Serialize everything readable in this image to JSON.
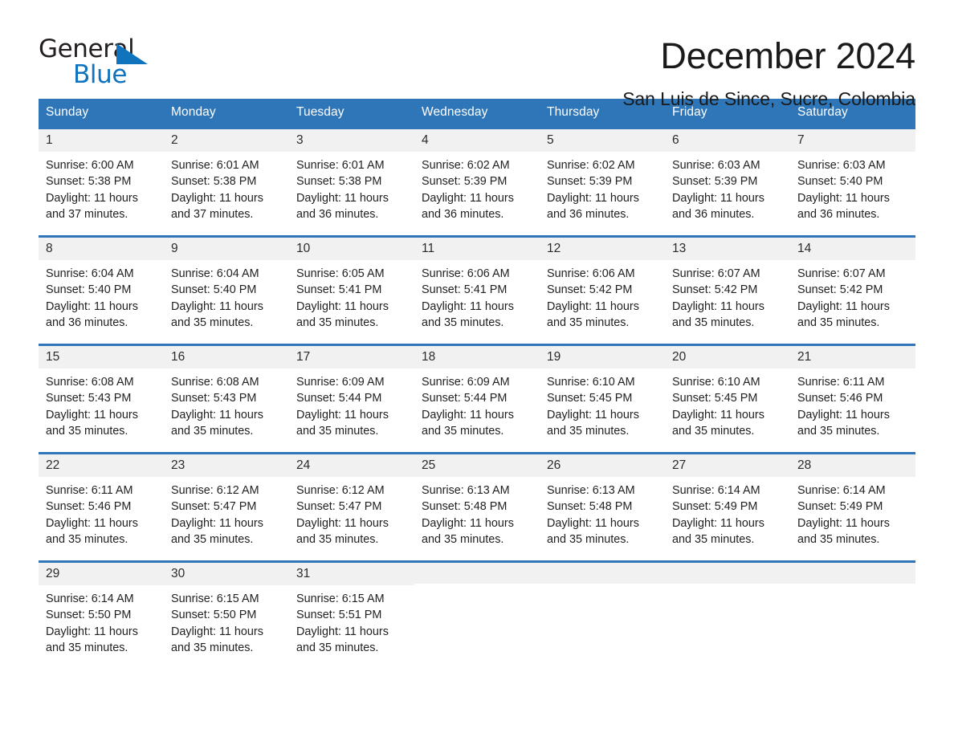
{
  "brand": {
    "name_top": "General",
    "name_bottom": "Blue",
    "accent_color": "#1073be",
    "triangle_icon": "triangle-icon"
  },
  "header": {
    "title": "December 2024",
    "location": "San Luis de Since, Sucre, Colombia"
  },
  "calendar": {
    "header_color": "#2e76b8",
    "daynum_band_color": "#f1f1f1",
    "weekdays": [
      "Sunday",
      "Monday",
      "Tuesday",
      "Wednesday",
      "Thursday",
      "Friday",
      "Saturday"
    ],
    "weeks": [
      [
        {
          "day": "1",
          "sunrise": "Sunrise: 6:00 AM",
          "sunset": "Sunset: 5:38 PM",
          "daylight": "Daylight: 11 hours and 37 minutes."
        },
        {
          "day": "2",
          "sunrise": "Sunrise: 6:01 AM",
          "sunset": "Sunset: 5:38 PM",
          "daylight": "Daylight: 11 hours and 37 minutes."
        },
        {
          "day": "3",
          "sunrise": "Sunrise: 6:01 AM",
          "sunset": "Sunset: 5:38 PM",
          "daylight": "Daylight: 11 hours and 36 minutes."
        },
        {
          "day": "4",
          "sunrise": "Sunrise: 6:02 AM",
          "sunset": "Sunset: 5:39 PM",
          "daylight": "Daylight: 11 hours and 36 minutes."
        },
        {
          "day": "5",
          "sunrise": "Sunrise: 6:02 AM",
          "sunset": "Sunset: 5:39 PM",
          "daylight": "Daylight: 11 hours and 36 minutes."
        },
        {
          "day": "6",
          "sunrise": "Sunrise: 6:03 AM",
          "sunset": "Sunset: 5:39 PM",
          "daylight": "Daylight: 11 hours and 36 minutes."
        },
        {
          "day": "7",
          "sunrise": "Sunrise: 6:03 AM",
          "sunset": "Sunset: 5:40 PM",
          "daylight": "Daylight: 11 hours and 36 minutes."
        }
      ],
      [
        {
          "day": "8",
          "sunrise": "Sunrise: 6:04 AM",
          "sunset": "Sunset: 5:40 PM",
          "daylight": "Daylight: 11 hours and 36 minutes."
        },
        {
          "day": "9",
          "sunrise": "Sunrise: 6:04 AM",
          "sunset": "Sunset: 5:40 PM",
          "daylight": "Daylight: 11 hours and 35 minutes."
        },
        {
          "day": "10",
          "sunrise": "Sunrise: 6:05 AM",
          "sunset": "Sunset: 5:41 PM",
          "daylight": "Daylight: 11 hours and 35 minutes."
        },
        {
          "day": "11",
          "sunrise": "Sunrise: 6:06 AM",
          "sunset": "Sunset: 5:41 PM",
          "daylight": "Daylight: 11 hours and 35 minutes."
        },
        {
          "day": "12",
          "sunrise": "Sunrise: 6:06 AM",
          "sunset": "Sunset: 5:42 PM",
          "daylight": "Daylight: 11 hours and 35 minutes."
        },
        {
          "day": "13",
          "sunrise": "Sunrise: 6:07 AM",
          "sunset": "Sunset: 5:42 PM",
          "daylight": "Daylight: 11 hours and 35 minutes."
        },
        {
          "day": "14",
          "sunrise": "Sunrise: 6:07 AM",
          "sunset": "Sunset: 5:42 PM",
          "daylight": "Daylight: 11 hours and 35 minutes."
        }
      ],
      [
        {
          "day": "15",
          "sunrise": "Sunrise: 6:08 AM",
          "sunset": "Sunset: 5:43 PM",
          "daylight": "Daylight: 11 hours and 35 minutes."
        },
        {
          "day": "16",
          "sunrise": "Sunrise: 6:08 AM",
          "sunset": "Sunset: 5:43 PM",
          "daylight": "Daylight: 11 hours and 35 minutes."
        },
        {
          "day": "17",
          "sunrise": "Sunrise: 6:09 AM",
          "sunset": "Sunset: 5:44 PM",
          "daylight": "Daylight: 11 hours and 35 minutes."
        },
        {
          "day": "18",
          "sunrise": "Sunrise: 6:09 AM",
          "sunset": "Sunset: 5:44 PM",
          "daylight": "Daylight: 11 hours and 35 minutes."
        },
        {
          "day": "19",
          "sunrise": "Sunrise: 6:10 AM",
          "sunset": "Sunset: 5:45 PM",
          "daylight": "Daylight: 11 hours and 35 minutes."
        },
        {
          "day": "20",
          "sunrise": "Sunrise: 6:10 AM",
          "sunset": "Sunset: 5:45 PM",
          "daylight": "Daylight: 11 hours and 35 minutes."
        },
        {
          "day": "21",
          "sunrise": "Sunrise: 6:11 AM",
          "sunset": "Sunset: 5:46 PM",
          "daylight": "Daylight: 11 hours and 35 minutes."
        }
      ],
      [
        {
          "day": "22",
          "sunrise": "Sunrise: 6:11 AM",
          "sunset": "Sunset: 5:46 PM",
          "daylight": "Daylight: 11 hours and 35 minutes."
        },
        {
          "day": "23",
          "sunrise": "Sunrise: 6:12 AM",
          "sunset": "Sunset: 5:47 PM",
          "daylight": "Daylight: 11 hours and 35 minutes."
        },
        {
          "day": "24",
          "sunrise": "Sunrise: 6:12 AM",
          "sunset": "Sunset: 5:47 PM",
          "daylight": "Daylight: 11 hours and 35 minutes."
        },
        {
          "day": "25",
          "sunrise": "Sunrise: 6:13 AM",
          "sunset": "Sunset: 5:48 PM",
          "daylight": "Daylight: 11 hours and 35 minutes."
        },
        {
          "day": "26",
          "sunrise": "Sunrise: 6:13 AM",
          "sunset": "Sunset: 5:48 PM",
          "daylight": "Daylight: 11 hours and 35 minutes."
        },
        {
          "day": "27",
          "sunrise": "Sunrise: 6:14 AM",
          "sunset": "Sunset: 5:49 PM",
          "daylight": "Daylight: 11 hours and 35 minutes."
        },
        {
          "day": "28",
          "sunrise": "Sunrise: 6:14 AM",
          "sunset": "Sunset: 5:49 PM",
          "daylight": "Daylight: 11 hours and 35 minutes."
        }
      ],
      [
        {
          "day": "29",
          "sunrise": "Sunrise: 6:14 AM",
          "sunset": "Sunset: 5:50 PM",
          "daylight": "Daylight: 11 hours and 35 minutes."
        },
        {
          "day": "30",
          "sunrise": "Sunrise: 6:15 AM",
          "sunset": "Sunset: 5:50 PM",
          "daylight": "Daylight: 11 hours and 35 minutes."
        },
        {
          "day": "31",
          "sunrise": "Sunrise: 6:15 AM",
          "sunset": "Sunset: 5:51 PM",
          "daylight": "Daylight: 11 hours and 35 minutes."
        },
        {
          "day": "",
          "sunrise": "",
          "sunset": "",
          "daylight": ""
        },
        {
          "day": "",
          "sunrise": "",
          "sunset": "",
          "daylight": ""
        },
        {
          "day": "",
          "sunrise": "",
          "sunset": "",
          "daylight": ""
        },
        {
          "day": "",
          "sunrise": "",
          "sunset": "",
          "daylight": ""
        }
      ]
    ]
  }
}
